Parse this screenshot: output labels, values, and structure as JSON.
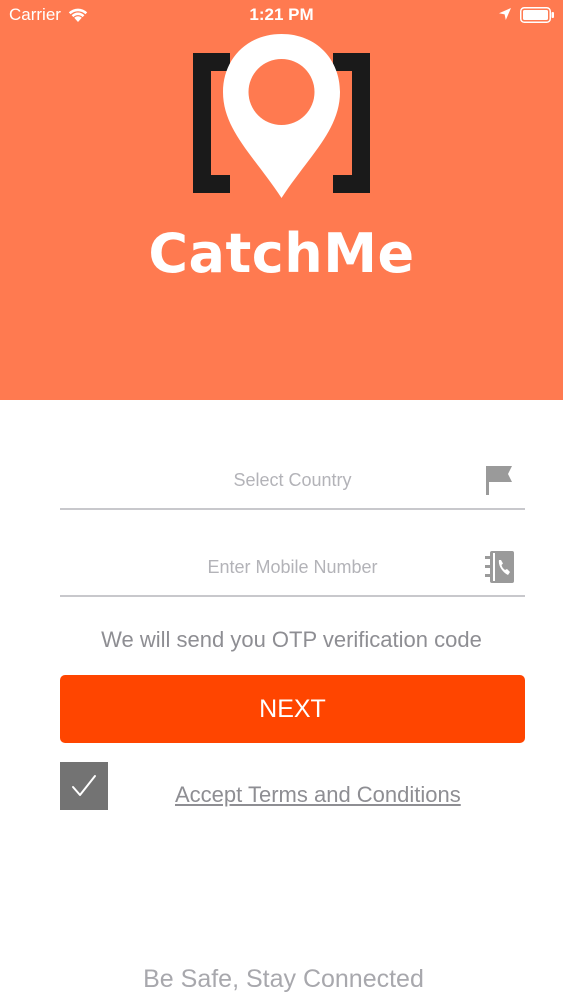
{
  "status_bar": {
    "carrier": "Carrier",
    "time": "1:21 PM",
    "icons": [
      "wifi-icon",
      "location-arrow-icon",
      "battery-icon"
    ]
  },
  "header": {
    "background_color": "#FF7A50",
    "logo_icon": "location-pin-bracket-logo",
    "app_name": "CatchMe"
  },
  "form": {
    "country": {
      "placeholder": "Select Country",
      "value": "",
      "icon": "flag-icon"
    },
    "mobile": {
      "placeholder": "Enter Mobile Number",
      "value": "",
      "icon": "contact-book-icon"
    },
    "otp_note": "We will send you OTP verification code",
    "next_label": "NEXT",
    "next_color": "#FF4500",
    "terms": {
      "checked": true,
      "label": "Accept Terms and Conditions"
    }
  },
  "footer": {
    "tagline": "Be Safe, Stay Connected"
  }
}
